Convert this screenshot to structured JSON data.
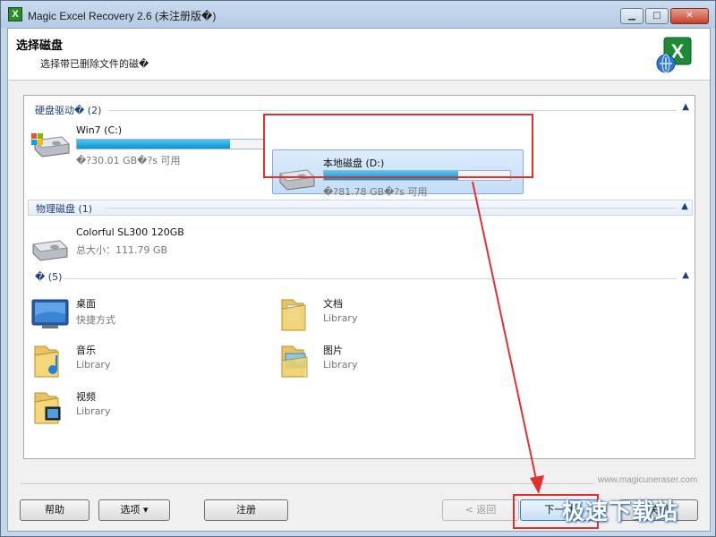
{
  "window": {
    "title": "Magic Excel Recovery 2.6 (未注册版�)",
    "app_icon": "excel-recovery-app-icon",
    "controls": {
      "minimize": "▁",
      "maximize": "□",
      "close": "✕"
    }
  },
  "header": {
    "title": "选择磁盘",
    "subtitle": "选择带已删除文件的磁�",
    "logo": "excel-x-logo"
  },
  "groups": {
    "hard_drives": {
      "label": "硬盘驱动� (2)",
      "chevron": "▲"
    },
    "physical": {
      "label": "物理磁盘 (1)",
      "chevron": "▲"
    },
    "folders": {
      "label": "� (5)",
      "chevron": "▲"
    }
  },
  "drives": [
    {
      "name": "Win7 (C:)",
      "free": "�?30.01 GB�?s 可用",
      "usage": 0.82,
      "icon": "windows-drive-icon"
    },
    {
      "name": "本地磁盘 (D:)",
      "free": "�?81.78 GB�?s 可用",
      "usage": 0.72,
      "icon": "hard-drive-icon",
      "selected": true
    }
  ],
  "physical_disks": [
    {
      "name": "Colorful SL300 120GB",
      "size": "总大小：111.79 GB",
      "icon": "hard-drive-icon"
    }
  ],
  "folders": [
    {
      "name": "桌面",
      "type": "快捷方式",
      "icon": "desktop-icon"
    },
    {
      "name": "文档",
      "type": "Library",
      "icon": "documents-folder-icon"
    },
    {
      "name": "音乐",
      "type": "Library",
      "icon": "music-folder-icon"
    },
    {
      "name": "图片",
      "type": "Library",
      "icon": "pictures-folder-icon"
    },
    {
      "name": "视频",
      "type": "Library",
      "icon": "videos-folder-icon"
    }
  ],
  "footer": {
    "website": "www.magicuneraser.com",
    "buttons": {
      "help": "帮助",
      "options": "选项 ▾",
      "register": "注册",
      "back": "< 返回",
      "next": "下一�",
      "cancel": "关闭"
    }
  },
  "watermark": "极速下载站",
  "colors": {
    "accent": "#1e3f7a",
    "bar_fill": "#0f93d3",
    "annotation_red": "#e03131",
    "selection": "#c4def6"
  }
}
